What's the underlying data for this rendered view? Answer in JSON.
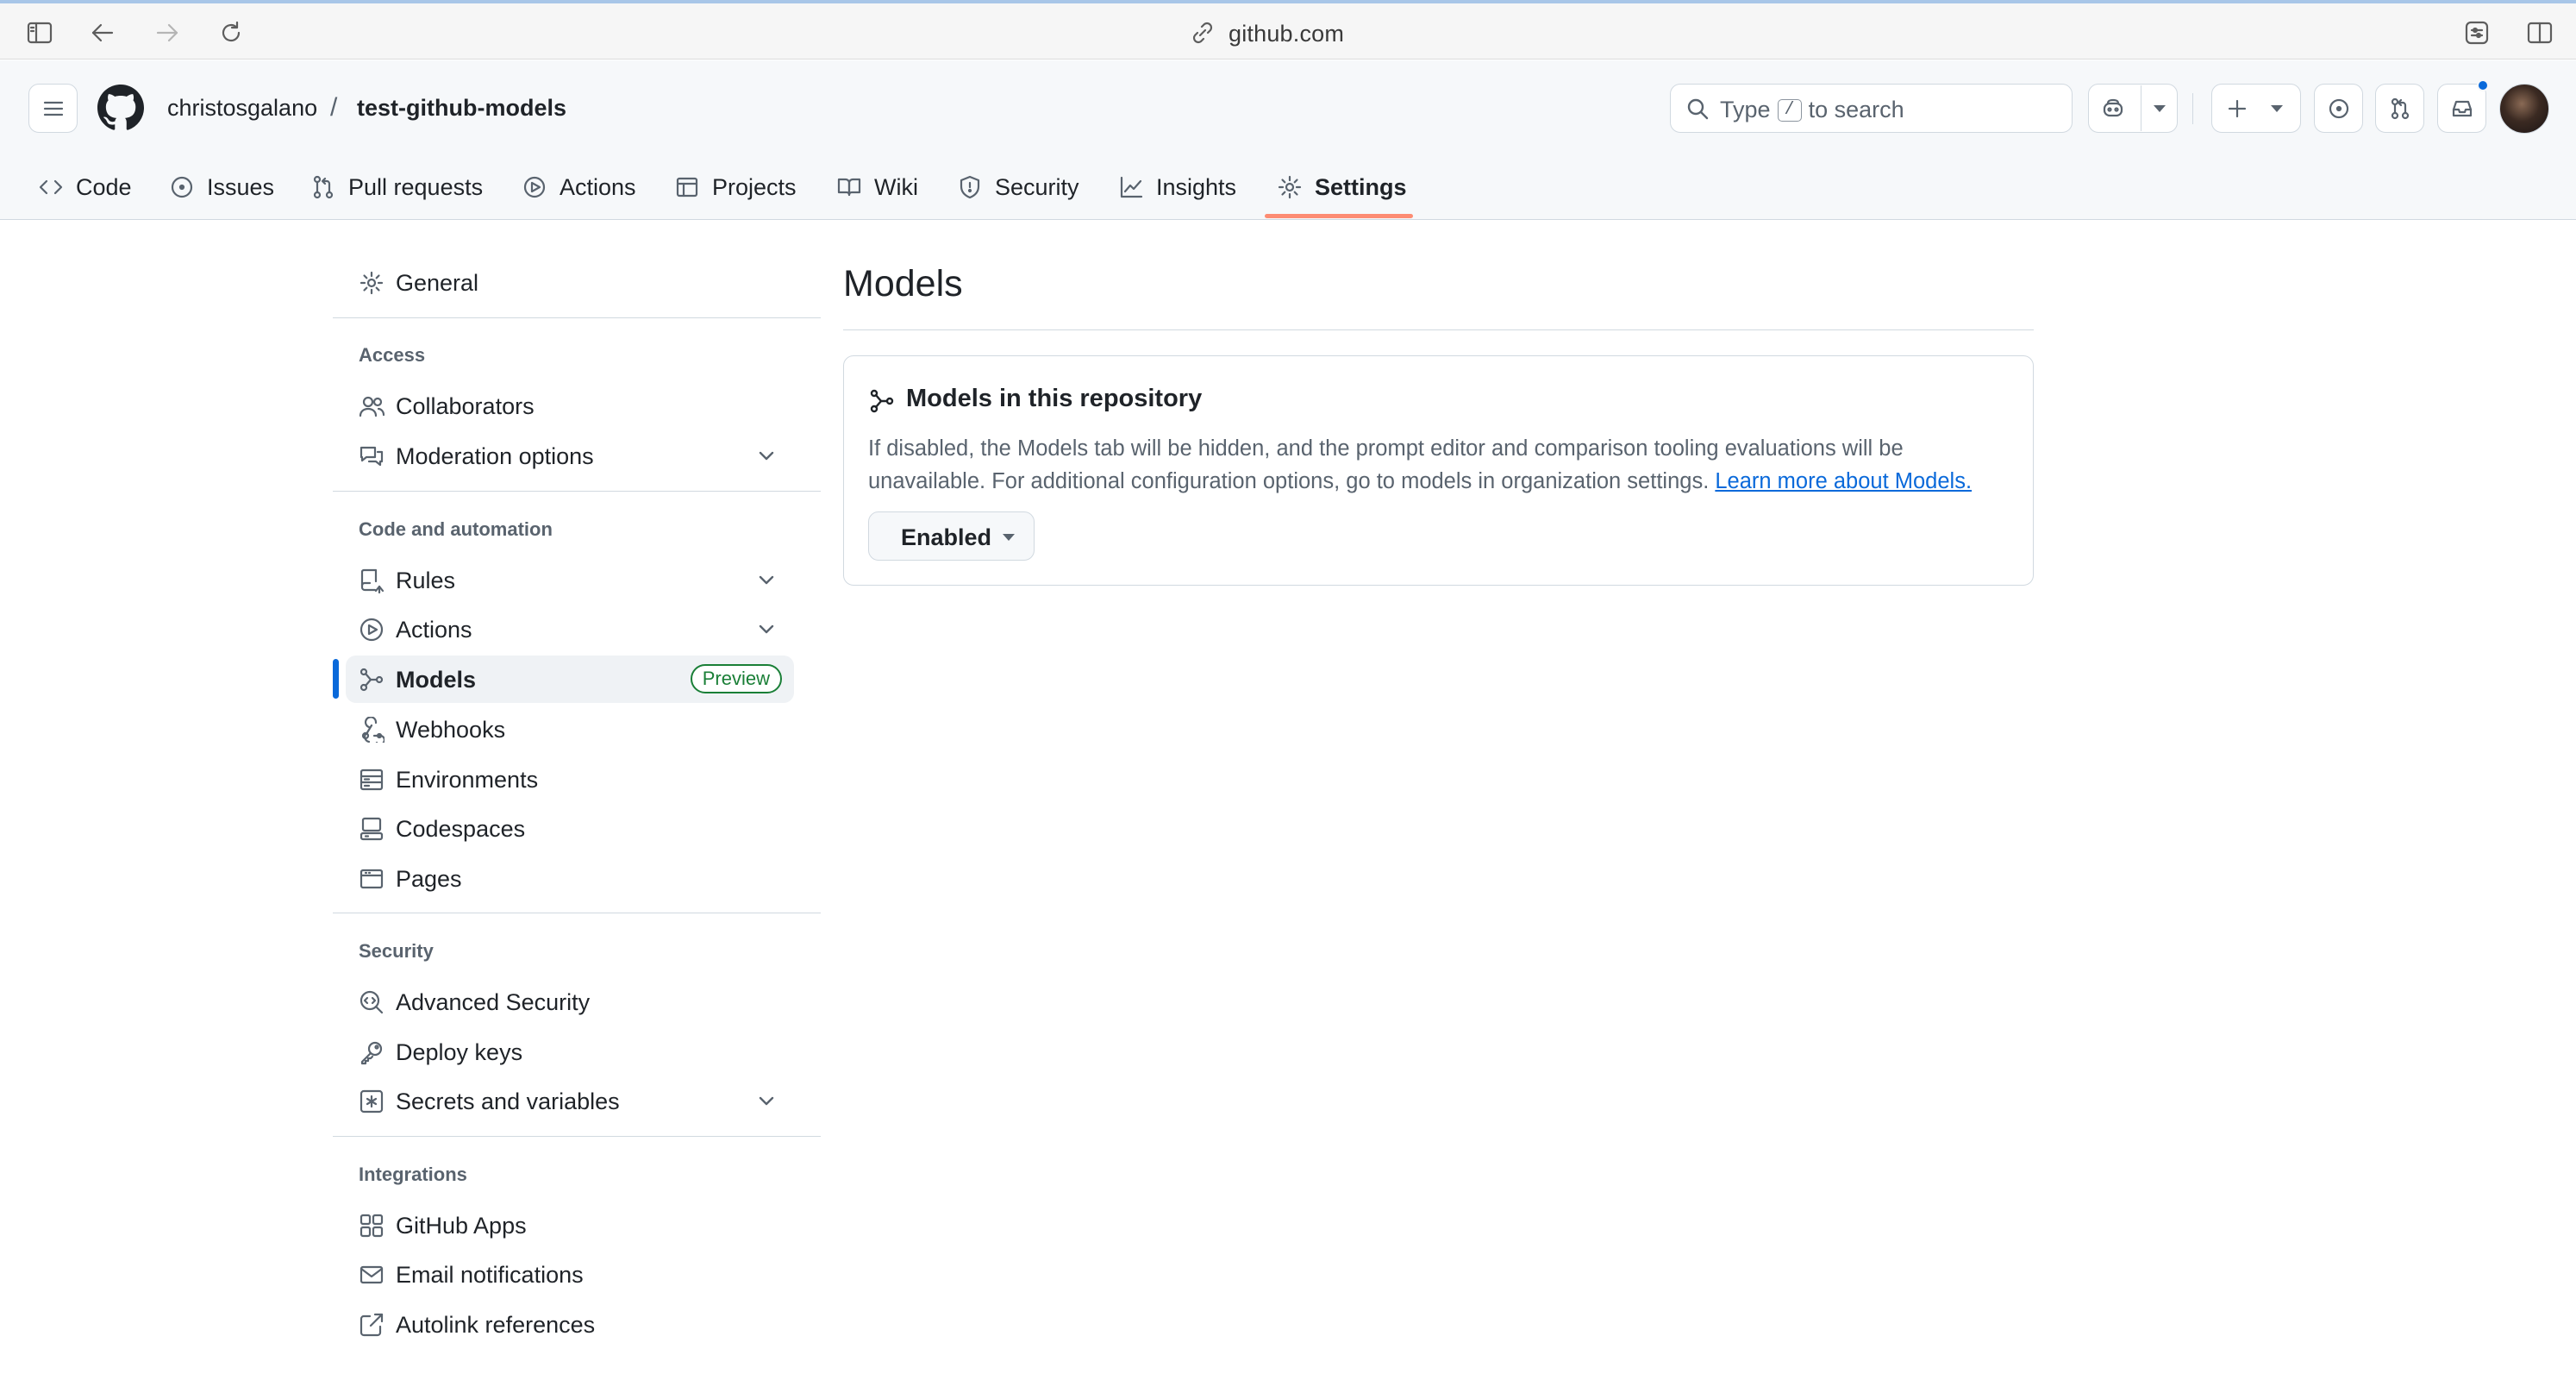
{
  "browser": {
    "url": "github.com"
  },
  "header": {
    "owner": "christosgalano",
    "separator": "/",
    "repo": "test-github-models",
    "search": {
      "prefix": "Type",
      "key": "/",
      "suffix": "to search"
    }
  },
  "tabs": [
    {
      "label": "Code",
      "icon": "code-icon"
    },
    {
      "label": "Issues",
      "icon": "issue-icon"
    },
    {
      "label": "Pull requests",
      "icon": "pull-request-icon"
    },
    {
      "label": "Actions",
      "icon": "play-icon"
    },
    {
      "label": "Projects",
      "icon": "table-icon"
    },
    {
      "label": "Wiki",
      "icon": "book-icon"
    },
    {
      "label": "Security",
      "icon": "shield-icon"
    },
    {
      "label": "Insights",
      "icon": "graph-icon"
    },
    {
      "label": "Settings",
      "icon": "gear-icon",
      "active": true
    }
  ],
  "sidebar": {
    "general": "General",
    "sections": {
      "access": "Access",
      "code_automation": "Code and automation",
      "security": "Security",
      "integrations": "Integrations"
    },
    "items": {
      "collaborators": "Collaborators",
      "moderation": "Moderation options",
      "rules": "Rules",
      "actions": "Actions",
      "models": "Models",
      "models_badge": "Preview",
      "webhooks": "Webhooks",
      "environments": "Environments",
      "codespaces": "Codespaces",
      "pages": "Pages",
      "advanced_security": "Advanced Security",
      "deploy_keys": "Deploy keys",
      "secrets": "Secrets and variables",
      "github_apps": "GitHub Apps",
      "email_notifications": "Email notifications",
      "autolink": "Autolink references"
    }
  },
  "main": {
    "title": "Models",
    "box": {
      "title": "Models in this repository",
      "description": "If disabled, the Models tab will be hidden, and the prompt editor and comparison tooling evaluations will be unavailable. For additional configuration options, go to models in organization settings.",
      "link": "Learn more about Models.",
      "select_value": "Enabled"
    }
  },
  "colors": {
    "accent": "#0969da",
    "tab_underline": "#fd8c73",
    "badge_green": "#1a7f37"
  }
}
